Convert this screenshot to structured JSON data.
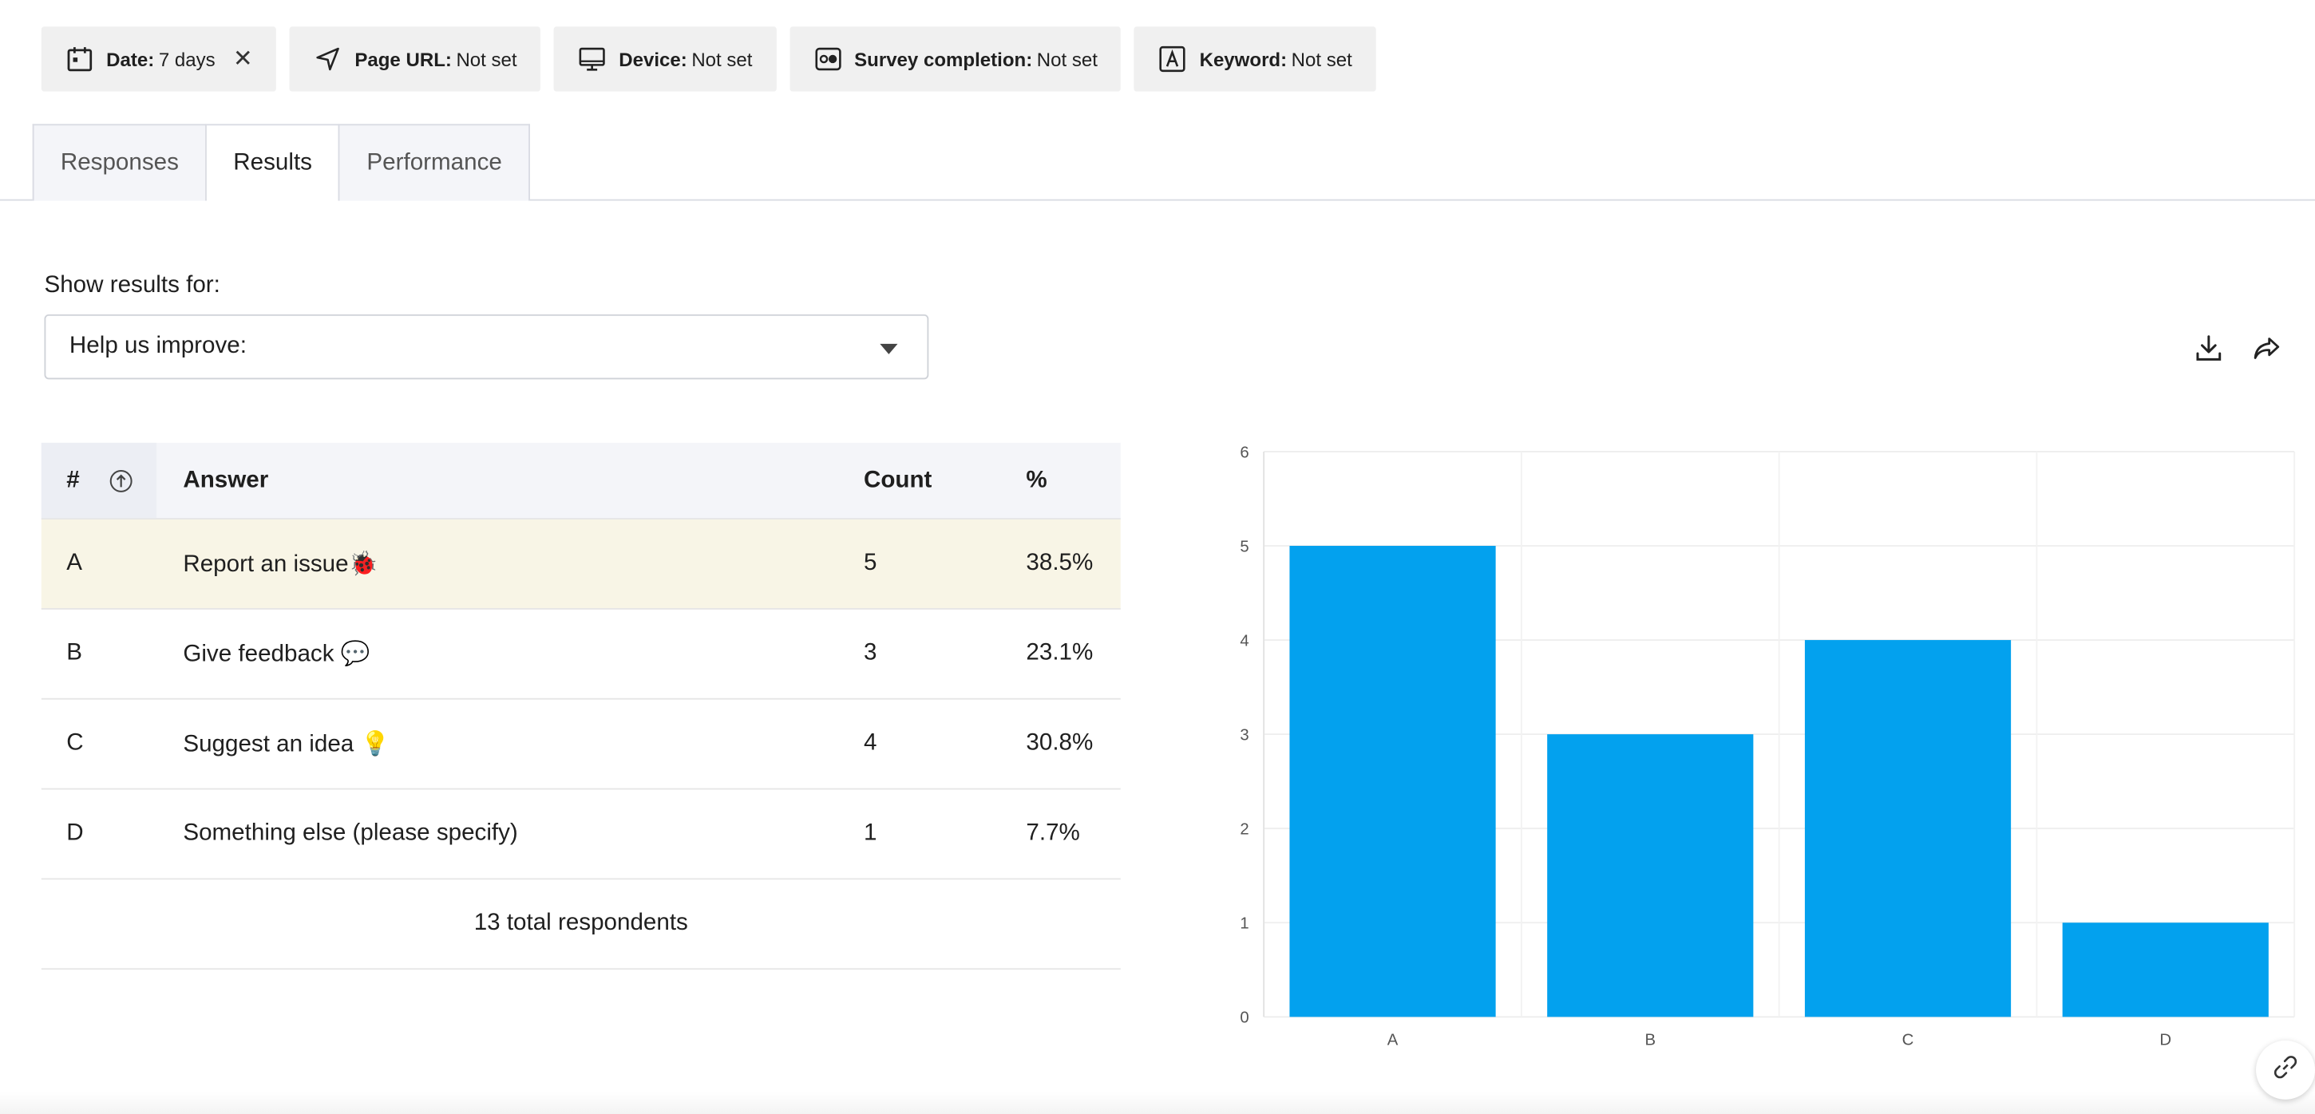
{
  "filters": [
    {
      "key": "Date:",
      "value": "7 days",
      "icon": "calendar-icon",
      "clearable": true
    },
    {
      "key": "Page URL:",
      "value": "Not set",
      "icon": "location-arrow-icon"
    },
    {
      "key": "Device:",
      "value": "Not set",
      "icon": "monitor-icon"
    },
    {
      "key": "Survey completion:",
      "value": "Not set",
      "icon": "toggle-icon"
    },
    {
      "key": "Keyword:",
      "value": "Not set",
      "icon": "letter-a-icon"
    }
  ],
  "clear_glyph": "✕",
  "tabs": [
    {
      "label": "Responses",
      "active": false
    },
    {
      "label": "Results",
      "active": true
    },
    {
      "label": "Performance",
      "active": false
    }
  ],
  "results": {
    "label": "Show results for:",
    "selected": "Help us improve:"
  },
  "table": {
    "headers": {
      "num": "#",
      "answer": "Answer",
      "count": "Count",
      "pct": "%"
    },
    "rows": [
      {
        "id": "A",
        "answer": "Report an issue🐞",
        "count": "5",
        "pct": "38.5%"
      },
      {
        "id": "B",
        "answer": "Give feedback 💬",
        "count": "3",
        "pct": "23.1%"
      },
      {
        "id": "C",
        "answer": "Suggest an idea 💡",
        "count": "4",
        "pct": "30.8%"
      },
      {
        "id": "D",
        "answer": "Something else (please specify)",
        "count": "1",
        "pct": "7.7%"
      }
    ],
    "total": "13 total respondents"
  },
  "chart_data": {
    "type": "bar",
    "categories": [
      "A",
      "B",
      "C",
      "D"
    ],
    "values": [
      5,
      3,
      4,
      1
    ],
    "ylim": [
      0,
      6
    ],
    "yticks": [
      0,
      1,
      2,
      3,
      4,
      5,
      6
    ],
    "grid": true,
    "color": "#03a1ee"
  },
  "colors": {
    "bar": "#03a1ee",
    "highlight_row": "#f8f5e6",
    "header_bg": "#f4f5f9"
  }
}
